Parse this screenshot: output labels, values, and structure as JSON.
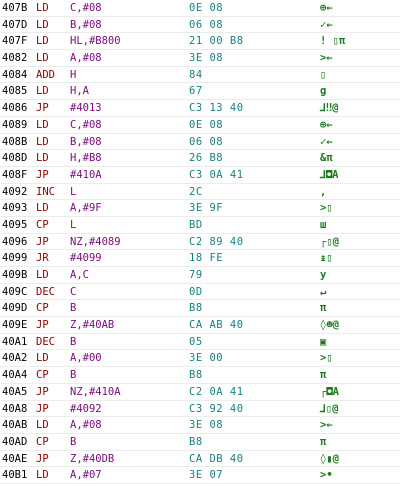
{
  "colors": {
    "address": "#000000",
    "mnemonic": "#8b0000",
    "operand": "#7a0a7a",
    "bytes": "#1a8080",
    "chars": "#1e7a1e"
  },
  "rows": [
    {
      "addr": "407B",
      "mnem": "LD",
      "oper": "C,#08",
      "bytes": "0E 08",
      "chars": "⊕←"
    },
    {
      "addr": "407D",
      "mnem": "LD",
      "oper": "B,#08",
      "bytes": "06 08",
      "chars": "✓←"
    },
    {
      "addr": "407F",
      "mnem": "LD",
      "oper": "HL,#B800",
      "bytes": "21 00 B8",
      "chars": "! ▯π"
    },
    {
      "addr": "4082",
      "mnem": "LD",
      "oper": "A,#08",
      "bytes": "3E 08",
      "chars": ">←"
    },
    {
      "addr": "4084",
      "mnem": "ADD",
      "oper": "H",
      "bytes": "84",
      "chars": "▯"
    },
    {
      "addr": "4085",
      "mnem": "LD",
      "oper": "H,A",
      "bytes": "67",
      "chars": "g"
    },
    {
      "addr": "4086",
      "mnem": "JP",
      "oper": "#4013",
      "bytes": "C3 13 40",
      "chars": "⅃‼@"
    },
    {
      "addr": "4089",
      "mnem": "LD",
      "oper": "C,#08",
      "bytes": "0E 08",
      "chars": "⊕←"
    },
    {
      "addr": "408B",
      "mnem": "LD",
      "oper": "B,#08",
      "bytes": "06 08",
      "chars": "✓←"
    },
    {
      "addr": "408D",
      "mnem": "LD",
      "oper": "H,#B8",
      "bytes": "26 B8",
      "chars": "&π"
    },
    {
      "addr": "408F",
      "mnem": "JP",
      "oper": "#410A",
      "bytes": "C3 0A 41",
      "chars": "⅃◘A"
    },
    {
      "addr": "4092",
      "mnem": "INC",
      "oper": "L",
      "bytes": "2C",
      "chars": ","
    },
    {
      "addr": "4093",
      "mnem": "LD",
      "oper": "A,#9F",
      "bytes": "3E 9F",
      "chars": ">▯"
    },
    {
      "addr": "4095",
      "mnem": "CP",
      "oper": "L",
      "bytes": "BD",
      "chars": "ш"
    },
    {
      "addr": "4096",
      "mnem": "JP",
      "oper": "NZ,#4089",
      "bytes": "C2 89 40",
      "chars": "┌▯@"
    },
    {
      "addr": "4099",
      "mnem": "JR",
      "oper": "#4099",
      "bytes": "18 FE",
      "chars": "↨▯"
    },
    {
      "addr": "409B",
      "mnem": "LD",
      "oper": "A,C",
      "bytes": "79",
      "chars": "y"
    },
    {
      "addr": "409C",
      "mnem": "DEC",
      "oper": "C",
      "bytes": "0D",
      "chars": "↵"
    },
    {
      "addr": "409D",
      "mnem": "CP",
      "oper": "B",
      "bytes": "B8",
      "chars": "π"
    },
    {
      "addr": "409E",
      "mnem": "JP",
      "oper": "Z,#40AB",
      "bytes": "CA AB 40",
      "chars": "◊☻@"
    },
    {
      "addr": "40A1",
      "mnem": "DEC",
      "oper": "B",
      "bytes": "05",
      "chars": "▣"
    },
    {
      "addr": "40A2",
      "mnem": "LD",
      "oper": "A,#00",
      "bytes": "3E 00",
      "chars": ">▯"
    },
    {
      "addr": "40A4",
      "mnem": "CP",
      "oper": "B",
      "bytes": "B8",
      "chars": "π"
    },
    {
      "addr": "40A5",
      "mnem": "JP",
      "oper": "NZ,#410A",
      "bytes": "C2 0A 41",
      "chars": "┌◘A"
    },
    {
      "addr": "40A8",
      "mnem": "JP",
      "oper": "#4092",
      "bytes": "C3 92 40",
      "chars": "⅃▯@"
    },
    {
      "addr": "40AB",
      "mnem": "LD",
      "oper": "A,#08",
      "bytes": "3E 08",
      "chars": ">←"
    },
    {
      "addr": "40AD",
      "mnem": "CP",
      "oper": "B",
      "bytes": "B8",
      "chars": "π"
    },
    {
      "addr": "40AE",
      "mnem": "JP",
      "oper": "Z,#40DB",
      "bytes": "CA DB 40",
      "chars": "◊▮@"
    },
    {
      "addr": "40B1",
      "mnem": "LD",
      "oper": "A,#07",
      "bytes": "3E 07",
      "chars": ">•"
    }
  ]
}
